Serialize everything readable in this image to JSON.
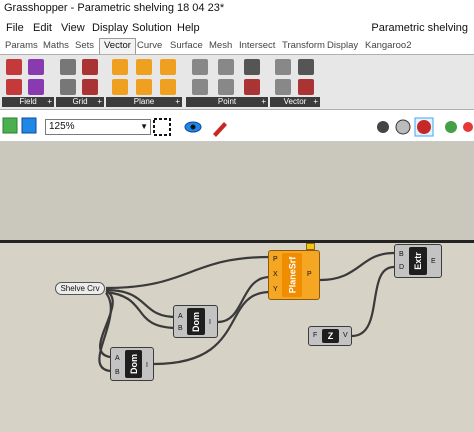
{
  "window": {
    "title": "Grasshopper - Parametric shelving 18 04 23*"
  },
  "menu": {
    "items": [
      "File",
      "Edit",
      "View",
      "Display",
      "Solution",
      "Help"
    ],
    "document_name": "Parametric shelving"
  },
  "tabs": [
    "Params",
    "Maths",
    "Sets",
    "Vector",
    "Curve",
    "Surface",
    "Mesh",
    "Intersect",
    "Transform",
    "Display",
    "Kangaroo2"
  ],
  "active_tab": "Vector",
  "ribbon_groups": [
    "Field",
    "Grid",
    "Plane",
    "Point",
    "Vector"
  ],
  "toolbar": {
    "zoom": "125%"
  },
  "components": {
    "param": {
      "label": "Shelve Crv"
    },
    "plane_srf": {
      "name": "PlaneSrf",
      "inputs": [
        "P",
        "X",
        "Y"
      ],
      "outputs": [
        "P"
      ]
    },
    "extrude": {
      "name": "Extr",
      "inputs": [
        "B",
        "D"
      ],
      "outputs": [
        "E"
      ]
    },
    "domain_a": {
      "name": "Dom",
      "inputs": [
        "A",
        "B"
      ],
      "outputs": [
        "I"
      ]
    },
    "domain_b": {
      "name": "Dom",
      "inputs": [
        "A",
        "B"
      ],
      "outputs": [
        "I"
      ]
    },
    "unit_z": {
      "name": "Z",
      "inputs": [
        "F"
      ],
      "outputs": [
        "V"
      ]
    }
  }
}
